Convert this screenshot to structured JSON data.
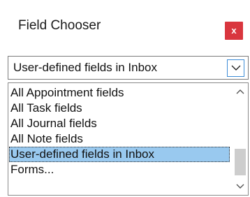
{
  "window": {
    "title": "Field Chooser",
    "close_label": "x"
  },
  "dropdown": {
    "selected": "User-defined fields in Inbox",
    "button_icon": "chevron-down-icon"
  },
  "list": {
    "items": [
      {
        "label": "All Appointment fields"
      },
      {
        "label": "All Task fields"
      },
      {
        "label": "All Journal fields"
      },
      {
        "label": "All Note fields"
      },
      {
        "label": "User-defined fields in Inbox",
        "selected": true
      },
      {
        "label": "Forms..."
      }
    ]
  },
  "scrollbar": {
    "up_icon": "chevron-up-icon",
    "down_icon": "chevron-down-icon"
  },
  "colors": {
    "close_button": "#d9363e",
    "selection": "#99c9ef",
    "dropdown_button_border": "#3c8cd6",
    "scroll_thumb": "#cdcdcd"
  }
}
